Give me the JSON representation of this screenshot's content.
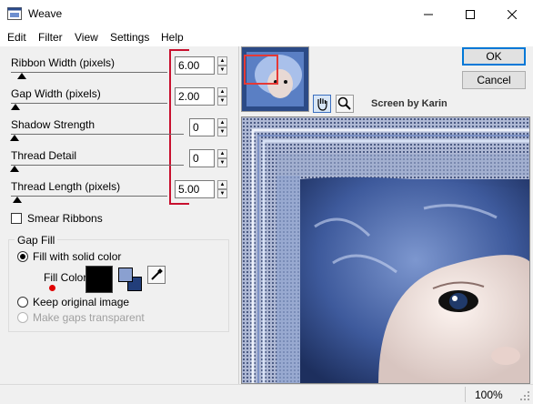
{
  "window": {
    "title": "Weave"
  },
  "menu": [
    "Edit",
    "Filter",
    "View",
    "Settings",
    "Help"
  ],
  "params": {
    "ribbon_width": {
      "label": "Ribbon Width (pixels)",
      "value": "6.00"
    },
    "gap_width": {
      "label": "Gap Width (pixels)",
      "value": "2.00"
    },
    "shadow_strength": {
      "label": "Shadow Strength",
      "value": "0"
    },
    "thread_detail": {
      "label": "Thread Detail",
      "value": "0"
    },
    "thread_length": {
      "label": "Thread Length (pixels)",
      "value": "5.00"
    }
  },
  "smear": {
    "label": "Smear Ribbons",
    "checked": false
  },
  "gap_fill": {
    "group_label": "Gap Fill",
    "fill_solid_label": "Fill with solid color",
    "fill_color_label": "Fill Color",
    "keep_original_label": "Keep original image",
    "transparent_label": "Make gaps transparent",
    "fill_color": "#000000"
  },
  "buttons": {
    "ok": "OK",
    "cancel": "Cancel"
  },
  "credit": "Screen by Karin",
  "zoom": "100%",
  "colors": {
    "accent_red": "#c8102e",
    "preview_blue": "#3a5ea8",
    "fg_swatch": "#8aa0d0",
    "bg_swatch": "#223e7a"
  }
}
